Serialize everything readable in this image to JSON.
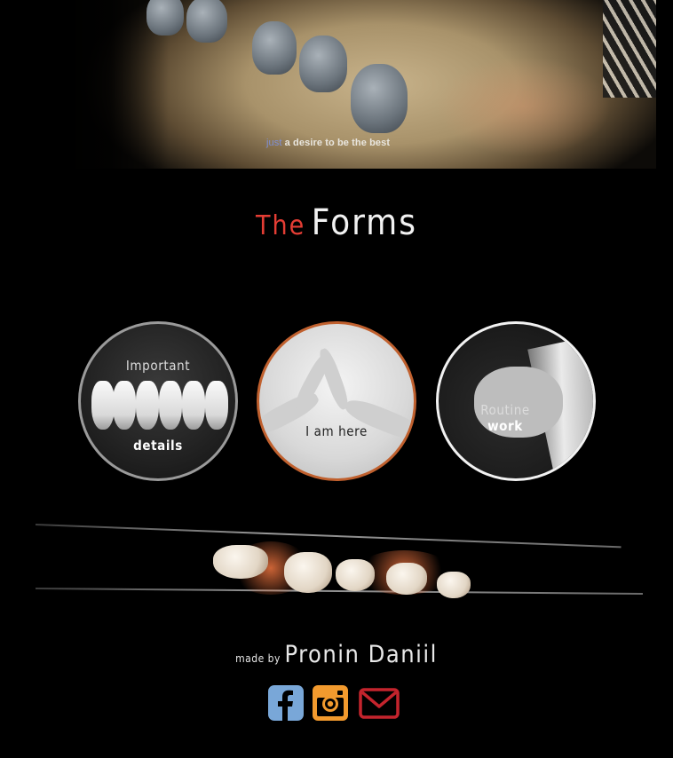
{
  "hero": {
    "tagline_accent": "just",
    "tagline_rest": " a desire to be the best"
  },
  "title": {
    "prefix": "The",
    "main": "Forms"
  },
  "forms": [
    {
      "line1": "Important",
      "line2": "details"
    },
    {
      "line1": "I am here"
    },
    {
      "line1": "Routine",
      "line2": "work"
    }
  ],
  "footer": {
    "made_by_label": "made by",
    "author": "Pronin Daniil"
  },
  "social": [
    {
      "icon": "facebook-icon",
      "color": "#79a7d8"
    },
    {
      "icon": "instagram-icon",
      "color": "#f29a2e"
    },
    {
      "icon": "mail-icon",
      "color": "#c4242d"
    }
  ],
  "colors": {
    "background": "#000000",
    "title_accent": "#e43d34",
    "tagline_accent": "#7f8fd6",
    "circle1_border": "#9a9a9a",
    "circle2_border": "#c0602e",
    "circle3_border": "#f2f2f2"
  }
}
